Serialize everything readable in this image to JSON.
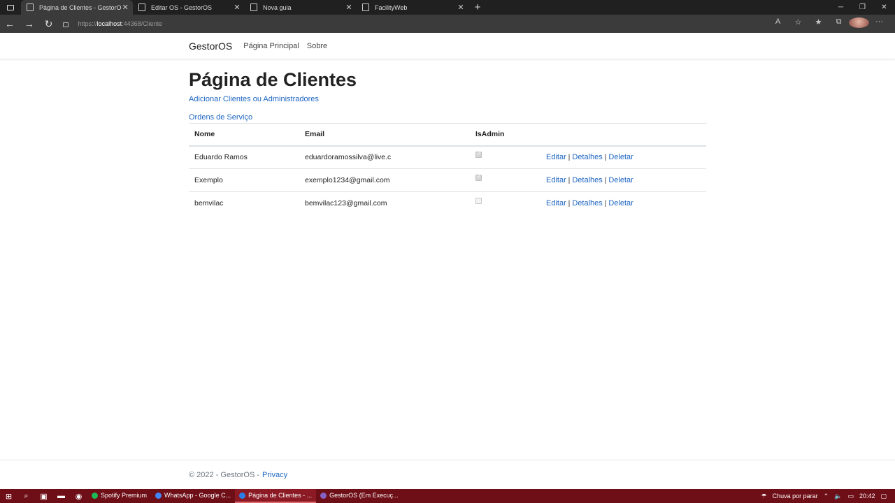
{
  "browser": {
    "tabs": [
      {
        "label": "Página de Clientes - GestorOS",
        "active": true
      },
      {
        "label": "Editar OS - GestorOS",
        "active": false
      },
      {
        "label": "Nova guia",
        "active": false
      },
      {
        "label": "FacilityWeb",
        "active": false
      }
    ],
    "url_scheme": "https://",
    "url_host": "localhost",
    "url_rest": ":44368/Cliente"
  },
  "navbar": {
    "brand": "GestorOS",
    "links": [
      "Página Principal",
      "Sobre"
    ]
  },
  "main": {
    "title": "Página de Clientes",
    "create_link": "Adicionar Clientes ou Administradores",
    "orders_link": "Ordens de Serviço",
    "table": {
      "headers": [
        "Nome",
        "Email",
        "IsAdmin"
      ],
      "rows": [
        {
          "nome": "Eduardo Ramos",
          "email": "eduardoramossilva@live.c",
          "is_admin": true
        },
        {
          "nome": "Exemplo",
          "email": "exemplo1234@gmail.com",
          "is_admin": true
        },
        {
          "nome": "bemvilac",
          "email": "bemvilac123@gmail.com",
          "is_admin": false
        }
      ],
      "actions": {
        "edit": "Editar",
        "details": "Detalhes",
        "delete": "Deletar",
        "separator": "|"
      }
    }
  },
  "footer": {
    "text": "© 2022 - GestorOS -",
    "privacy": "Privacy"
  },
  "taskbar": {
    "apps": [
      {
        "label": "Spotify Premium",
        "color": "#1db954",
        "active": false
      },
      {
        "label": "WhatsApp - Google C...",
        "color": "#4285f4",
        "active": false
      },
      {
        "label": "Página de Clientes - ...",
        "color": "#2b7de9",
        "active": true
      },
      {
        "label": "GestorOS (Em Execuç...",
        "color": "#8661c5",
        "active": false
      }
    ],
    "weather": "Chuva por parar",
    "time": "20:42"
  },
  "colors": {
    "link": "#1e66c2",
    "taskbar": "#6e0e16",
    "browser_dark": "#202020"
  }
}
